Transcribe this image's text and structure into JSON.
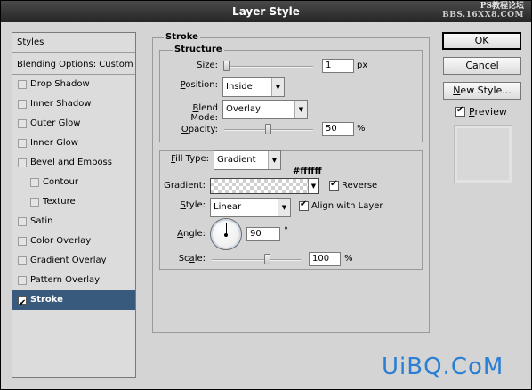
{
  "window": {
    "title": "Layer Style"
  },
  "watermark": {
    "line1": "PS教程论坛",
    "line2": "BBS.16XX8.COM",
    "logo": "UiBQ.CoM"
  },
  "sidebar": {
    "header": "Styles",
    "blending": "Blending Options: Custom",
    "items": [
      {
        "label": "Drop Shadow",
        "checked": false
      },
      {
        "label": "Inner Shadow",
        "checked": false
      },
      {
        "label": "Outer Glow",
        "checked": false
      },
      {
        "label": "Inner Glow",
        "checked": false
      },
      {
        "label": "Bevel and Emboss",
        "checked": false
      },
      {
        "label": "Contour",
        "checked": false
      },
      {
        "label": "Texture",
        "checked": false
      },
      {
        "label": "Satin",
        "checked": false
      },
      {
        "label": "Color Overlay",
        "checked": false
      },
      {
        "label": "Gradient Overlay",
        "checked": false
      },
      {
        "label": "Pattern Overlay",
        "checked": false
      },
      {
        "label": "Stroke",
        "checked": true
      }
    ]
  },
  "stroke": {
    "title": "Stroke",
    "structure": {
      "title": "Structure",
      "size_label": "Size:",
      "size_value": "1",
      "size_unit": "px",
      "position_label": "Position:",
      "position_value": "Inside",
      "blend_label": "Blend Mode:",
      "blend_value": "Overlay",
      "opacity_label": "Opacity:",
      "opacity_value": "50",
      "opacity_unit": "%"
    },
    "fill": {
      "type_label": "Fill Type:",
      "type_value": "Gradient",
      "color_note": "#ffffff",
      "gradient_label": "Gradient:",
      "reverse_label": "Reverse",
      "reverse_checked": true,
      "style_label": "Style:",
      "style_value": "Linear",
      "align_label": "Align with Layer",
      "align_checked": true,
      "angle_label": "Angle:",
      "angle_value": "90",
      "angle_unit": "°",
      "scale_label": "Scale:",
      "scale_value": "100",
      "scale_unit": "%"
    }
  },
  "buttons": {
    "ok": "OK",
    "cancel": "Cancel",
    "new_style": "New Style...",
    "preview": "Preview"
  },
  "preview_checked": true,
  "colors": {
    "selected": "#385a7c",
    "watermark_logo": "#2a7fd4"
  }
}
